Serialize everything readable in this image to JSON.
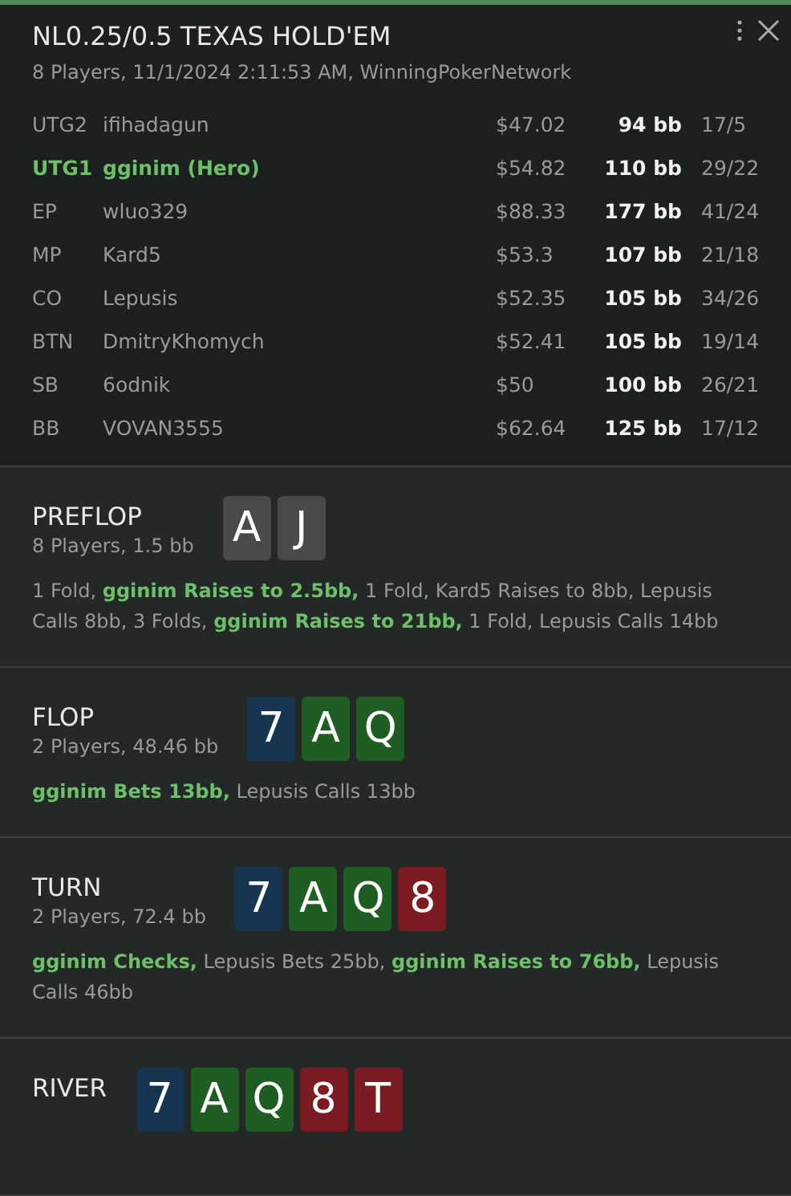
{
  "header": {
    "title": "NL0.25/0.5 TEXAS HOLD'EM",
    "subtitle": "8 Players, 11/1/2024 2:11:53 AM, WinningPokerNetwork"
  },
  "players": [
    {
      "position": "UTG2",
      "name": "ifihadagun",
      "stack": "$47.02",
      "bb": "94 bb",
      "stats": "17/5",
      "hero": false
    },
    {
      "position": "UTG1",
      "name": "gginim (Hero)",
      "stack": "$54.82",
      "bb": "110 bb",
      "stats": "29/22",
      "hero": true
    },
    {
      "position": "EP",
      "name": "wluo329",
      "stack": "$88.33",
      "bb": "177 bb",
      "stats": "41/24",
      "hero": false
    },
    {
      "position": "MP",
      "name": "Kard5",
      "stack": "$53.3",
      "bb": "107 bb",
      "stats": "21/18",
      "hero": false
    },
    {
      "position": "CO",
      "name": "Lepusis",
      "stack": "$52.35",
      "bb": "105 bb",
      "stats": "34/26",
      "hero": false
    },
    {
      "position": "BTN",
      "name": "DmitryKhomych",
      "stack": "$52.41",
      "bb": "105 bb",
      "stats": "19/14",
      "hero": false
    },
    {
      "position": "SB",
      "name": "6odnik",
      "stack": "$50",
      "bb": "100 bb",
      "stats": "26/21",
      "hero": false
    },
    {
      "position": "BB",
      "name": "VOVAN3555",
      "stack": "$62.64",
      "bb": "125 bb",
      "stats": "17/12",
      "hero": false
    }
  ],
  "streets": [
    {
      "name": "PREFLOP",
      "info": "8 Players, 1.5 bb",
      "cards": [
        {
          "rank": "A",
          "color": "#4a4a4a"
        },
        {
          "rank": "J",
          "color": "#4a4a4a"
        }
      ],
      "actions": "1 Fold, **gginim Raises to 2.5bb,** 1 Fold, Kard5 Raises to 8bb, Lepusis Calls 8bb, 3 Folds, **gginim Raises to 21bb,** 1 Fold, Lepusis Calls 14bb"
    },
    {
      "name": "FLOP",
      "info": "2 Players, 48.46 bb",
      "cards": [
        {
          "rank": "7",
          "color": "#173550"
        },
        {
          "rank": "A",
          "color": "#1f5e22"
        },
        {
          "rank": "Q",
          "color": "#1f5e22"
        }
      ],
      "actions": "**gginim Bets 13bb,** Lepusis Calls 13bb"
    },
    {
      "name": "TURN",
      "info": "2 Players, 72.4 bb",
      "cards": [
        {
          "rank": "7",
          "color": "#173550"
        },
        {
          "rank": "A",
          "color": "#1f5e22"
        },
        {
          "rank": "Q",
          "color": "#1f5e22"
        },
        {
          "rank": "8",
          "color": "#7a1c22"
        }
      ],
      "actions": "**gginim Checks,** Lepusis Bets 25bb, **gginim Raises to 76bb,** Lepusis Calls 46bb"
    },
    {
      "name": "RIVER",
      "cards": [
        {
          "rank": "7",
          "color": "#173550"
        },
        {
          "rank": "A",
          "color": "#1f5e22"
        },
        {
          "rank": "Q",
          "color": "#1f5e22"
        },
        {
          "rank": "8",
          "color": "#7a1c22"
        },
        {
          "rank": "T",
          "color": "#7a1c22"
        }
      ]
    }
  ]
}
